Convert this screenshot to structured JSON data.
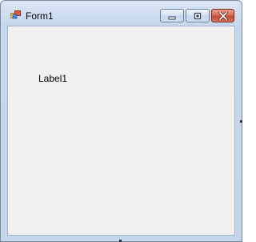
{
  "window": {
    "title": "Form1",
    "icon": "winforms-app-icon"
  },
  "caption_buttons": {
    "minimize_icon": "minimize-icon",
    "maximize_icon": "maximize-icon",
    "close_icon": "close-icon"
  },
  "form": {
    "label1_text": "Label1"
  },
  "colors": {
    "client_background": "#f0f0f0",
    "close_button": "#c44a2f",
    "frame": "#c3d6ec"
  }
}
